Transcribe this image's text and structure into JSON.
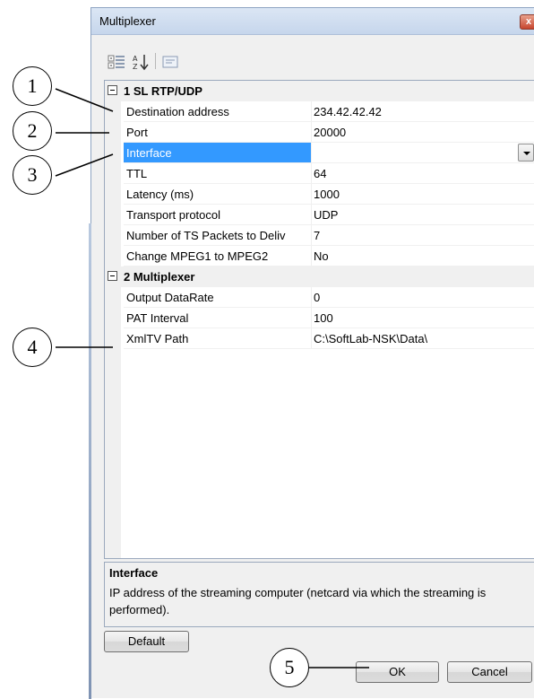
{
  "window": {
    "title": "Multiplexer",
    "close_glyph": "x"
  },
  "toolbar": {
    "icons": [
      "categorized-icon",
      "alphabetical-icon",
      "property-pages-icon"
    ]
  },
  "categories": [
    {
      "name": "1 SL RTP/UDP",
      "properties": [
        {
          "name": "Destination address",
          "value": "234.42.42.42"
        },
        {
          "name": "Port",
          "value": "20000"
        },
        {
          "name": "Interface",
          "value": ""
        },
        {
          "name": "TTL",
          "value": "64"
        },
        {
          "name": "Latency (ms)",
          "value": "1000"
        },
        {
          "name": "Transport protocol",
          "value": "UDP"
        },
        {
          "name": "Number of TS Packets to Deliv",
          "value": "7"
        },
        {
          "name": "Change MPEG1 to MPEG2",
          "value": "No"
        }
      ]
    },
    {
      "name": "2 Multiplexer",
      "properties": [
        {
          "name": "Output DataRate",
          "value": "0"
        },
        {
          "name": "PAT Interval",
          "value": "100"
        },
        {
          "name": "XmlTV Path",
          "value": "C:\\SoftLab-NSK\\Data\\"
        }
      ]
    }
  ],
  "description": {
    "title": "Interface",
    "text": "IP address of the streaming computer (netcard via which the streaming is performed)."
  },
  "buttons": {
    "default": "Default",
    "ok": "OK",
    "cancel": "Cancel"
  },
  "callouts": [
    "1",
    "2",
    "3",
    "4",
    "5"
  ],
  "colors": {
    "selection": "#3399ff",
    "titlebar": "#c6d6ec",
    "close": "#c7462f"
  }
}
